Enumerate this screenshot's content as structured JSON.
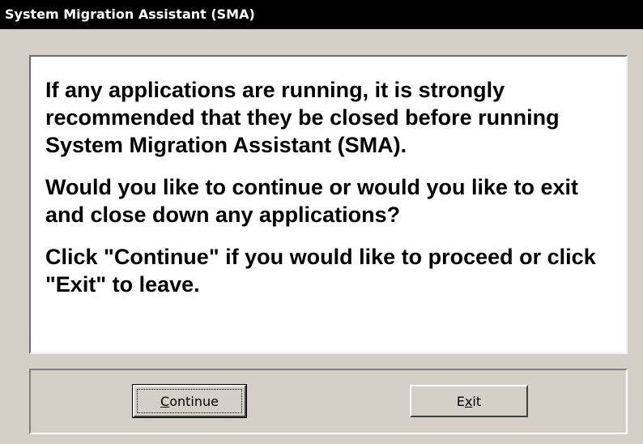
{
  "window": {
    "title": "System Migration Assistant (SMA)"
  },
  "message": {
    "paragraphs": [
      "If any applications are running, it is strongly recommended that they be closed before running System Migration Assistant (SMA).",
      "Would you like to continue or would you like to exit and close down any applications?",
      "Click \"Continue\" if you would like to proceed or click \"Exit\" to leave."
    ]
  },
  "buttons": {
    "continue": {
      "label": "Continue",
      "mnemonic": "C",
      "default": true
    },
    "exit": {
      "label": "Exit",
      "mnemonic": "x",
      "default": false
    }
  },
  "colors": {
    "title_bar": "#000000",
    "title_text": "#ffffff",
    "dialog_face": "#d4d0c8",
    "message_background": "#ffffff"
  }
}
